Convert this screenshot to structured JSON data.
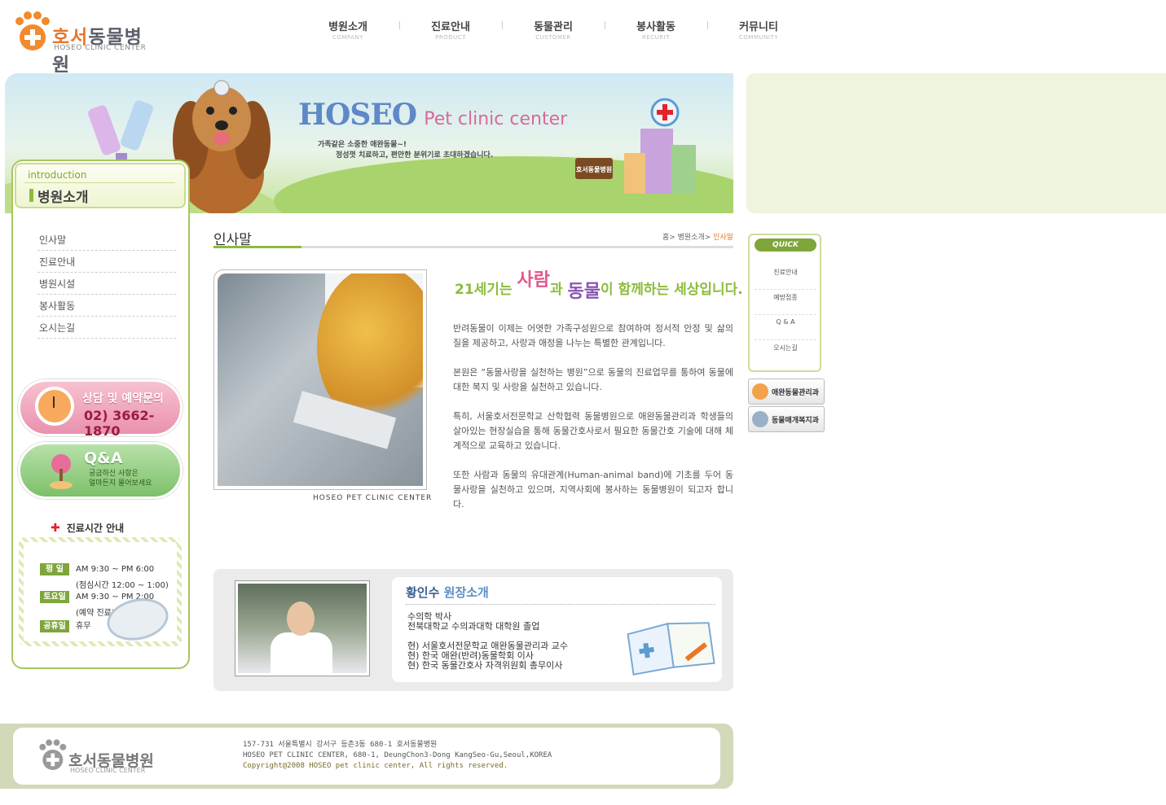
{
  "site": {
    "logo_name_accent": "호서",
    "logo_name_rest": "동물병원",
    "logo_sub": "HOSEO CLINIC CENTER"
  },
  "gnb": [
    {
      "ko": "병원소개",
      "en": "COMPANY"
    },
    {
      "ko": "진료안내",
      "en": "PRODUCT"
    },
    {
      "ko": "동물관리",
      "en": "CUSTOMER"
    },
    {
      "ko": "봉사활동",
      "en": "RECURIT"
    },
    {
      "ko": "커뮤니티",
      "en": "COMMUNITY"
    }
  ],
  "banner": {
    "title_main": "HOSEO",
    "title_sub": "Pet clinic center",
    "copy_line1": "가족같은 소중한 애완동물~!",
    "copy_line2": "정성껏 치료하고, 편안한 분위기로 초대하겠습니다.",
    "sign": "호서동물병원"
  },
  "lnb": {
    "head_en": "introduction",
    "head_ko": "병원소개",
    "items": [
      "인사말",
      "진료안내",
      "병원시설",
      "봉사활동",
      "오시는길"
    ]
  },
  "reservation": {
    "label": "상담 및 예약문의",
    "phone": "02) 3662-1870"
  },
  "qa_banner": {
    "title": "Q&A",
    "line1": "궁금하신 사항은",
    "line2": "얼마든지 물어보세요"
  },
  "hours": {
    "title": "진료시간 안내",
    "weekday_tag": "평 일",
    "weekday_time": "AM 9:30 ~ PM 6:00",
    "weekday_lunch": "(점심시간 12:00 ~ 1:00)",
    "saturday_tag": "토요일",
    "saturday_time": "AM 9:30 ~ PM 2:00",
    "saturday_note": "(예약 진료)",
    "holiday_tag": "공휴일",
    "holiday_text": "휴무"
  },
  "content": {
    "title": "인사말",
    "breadcrumb_home": "홈",
    "breadcrumb_section": "병원소개",
    "breadcrumb_current": "인사말",
    "photo_caption": "HOSEO PET CLINIC CENTER",
    "slogan_1": "21세기는 ",
    "slogan_person": "사람",
    "slogan_2": "과 ",
    "slogan_animal": "동물",
    "slogan_3": "이 함께하는 세상입니다.",
    "paragraphs": [
      "반려동물이 이제는 어엿한 가족구성원으로 참여하여 정서적 안정 및 삶의 질을 제공하고, 사랑과 애정을 나누는 특별한 관계입니다.",
      "본원은 “동물사랑을 실천하는 병원”으로 동물의 진료업무를 통하여 동물에 대한 복지 및 사랑을 실천하고 있습니다.",
      "특히, 서울호서전문학교 산학협력 동물병원으로 애완동물관리과 학생들의 살아있는 현장실습을 통해 동물간호사로서 필요한 동물간호 기술에 대해 체계적으로 교육하고 있습니다.",
      "또한 사람과 동물의 유대관계(Human-animal band)에 기초를 두어 동물사랑을 실천하고 있으며, 지역사회에 봉사하는 동물병원이 되고자 합니다."
    ]
  },
  "director": {
    "name": "황인수",
    "title": "원장소개",
    "lines_a": [
      "수의학 박사",
      "전북대학교 수의과대학 대학원 졸업"
    ],
    "lines_b": [
      "현) 서울호서전문학교 애완동물관리과 교수",
      "현) 한국 애완(반려)동물학회 이사",
      "현) 한국 동물간호사 자격위원회 총무이사"
    ]
  },
  "quick": {
    "title": "QUICK",
    "items": [
      "진료안내",
      "예방접종",
      "Q & A",
      "오시는길"
    ],
    "btn1": "애완동물관리과",
    "btn2": "동물매개복지과"
  },
  "footer": {
    "logo_name": "호서동물병원",
    "logo_sub": "HOSEO CLINIC CENTER",
    "address_ko": "157-731 서울특별시 강서구 등촌3동 680-1 호서동물병원",
    "address_en": "HOSEO PET CLINIC CENTER, 680-1, DeungChon3-Dong KangSeo-Gu,Seoul,KOREA",
    "copyright": "Copyright@2008 HOSEO pet clinic center, All rights reserved."
  },
  "colors": {
    "brand_orange": "#e8772a",
    "accent_green": "#8cbc3c",
    "pink": "#e2578b",
    "purple": "#8a55b5"
  }
}
